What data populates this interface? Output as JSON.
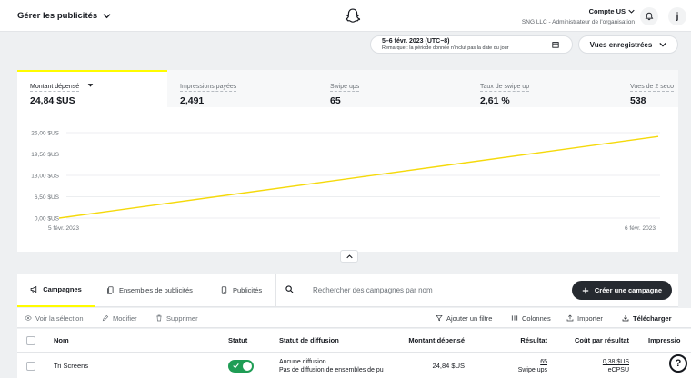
{
  "header": {
    "app_title": "Gérer les publicités",
    "account_name": "Compte US",
    "org_line": "SNG LLC - Administrateur de l'organisation",
    "avatar_letter": "j"
  },
  "date_range": {
    "label": "5–6 févr. 2023 (UTC−8)",
    "note": "Remarque : la période donnée n'inclut pas la date du jour"
  },
  "views_button": "Vues enregistrées",
  "metrics": [
    {
      "label": "Montant dépensé",
      "value": "24,84 $US"
    },
    {
      "label": "Impressions payées",
      "value": "2,491"
    },
    {
      "label": "Swipe ups",
      "value": "65"
    },
    {
      "label": "Taux de swipe up",
      "value": "2,61 %"
    },
    {
      "label": "Vues de 2 seco",
      "value": "538"
    }
  ],
  "chart_data": {
    "type": "line",
    "x": [
      "5 févr. 2023",
      "6 févr. 2023"
    ],
    "series": [
      {
        "values": [
          0,
          24.84
        ],
        "color": "#f5d90a"
      }
    ],
    "y_ticks": [
      "0,00 $US",
      "6,50 $US",
      "13,00 $US",
      "19,50 $US",
      "26,00 $US"
    ],
    "ylim": [
      0,
      26
    ],
    "grid": true
  },
  "tabs": [
    {
      "label": "Campagnes",
      "icon": "megaphone-icon",
      "active": true
    },
    {
      "label": "Ensembles de publicités",
      "icon": "adsets-icon",
      "active": false
    },
    {
      "label": "Publicités",
      "icon": "phone-icon",
      "active": false
    }
  ],
  "search": {
    "placeholder": "Rechercher des campagnes par nom",
    "value": ""
  },
  "create_button": "Créer une campagne",
  "toolbar": {
    "view": "Voir la sélection",
    "edit": "Modifier",
    "delete": "Supprimer",
    "filter": "Ajouter un filtre",
    "columns": "Colonnes",
    "import": "Importer",
    "download": "Télécharger"
  },
  "table": {
    "columns": [
      "Nom",
      "Statut",
      "Statut de diffusion",
      "Montant dépensé",
      "Résultat",
      "Coût par résultat",
      "Impressio"
    ],
    "rows": [
      {
        "name": "Tri Screens",
        "status_on": true,
        "delivery_line1": "Aucune diffusion",
        "delivery_line2": "Pas de diffusion de ensembles de pu",
        "spent": "24,84 $US",
        "result_value": "65",
        "result_unit": "Swipe ups",
        "cost_value": "0,38 $US",
        "cost_unit": "eCPSU"
      }
    ]
  },
  "colors": {
    "accent": "#fffc00",
    "line": "#f5d90a",
    "toggle_on": "#1f9d55",
    "dark_button": "#262a30"
  }
}
